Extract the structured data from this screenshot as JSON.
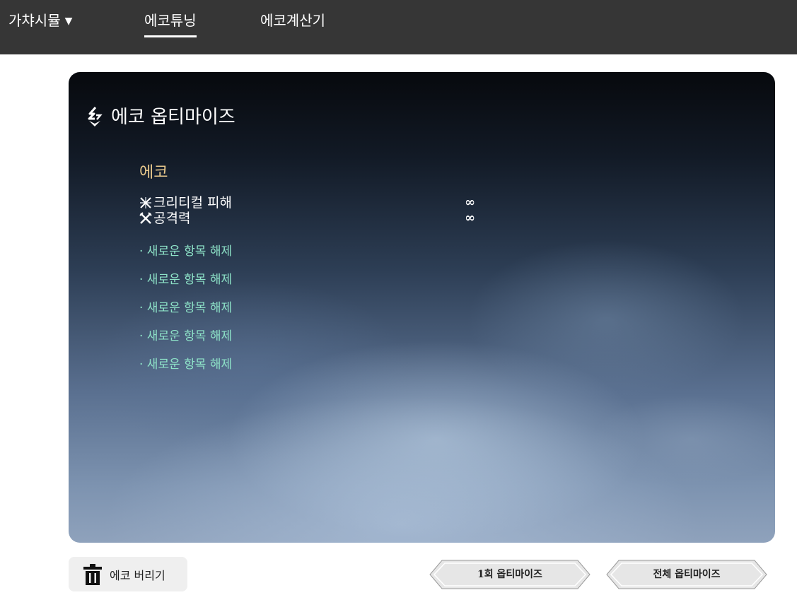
{
  "nav": {
    "gacha_label": "가챠시뮬",
    "gacha_caret": "▼",
    "tuning_label": "에코튜닝",
    "calculator_label": "에코계산기"
  },
  "panel": {
    "title": "에코 옵티마이즈",
    "echo_heading": "에코",
    "stats": [
      {
        "name": "크리티컬 피해",
        "value": "∞",
        "icon": "crit-damage-icon"
      },
      {
        "name": "공격력",
        "value": "∞",
        "icon": "attack-icon"
      }
    ],
    "unlock_slots": [
      "· 새로운 항목 해제",
      "· 새로운 항목 해제",
      "· 새로운 항목 해제",
      "· 새로운 항목 해제",
      "· 새로운 항목 해제"
    ]
  },
  "actions": {
    "discard_label": "에코 버리기",
    "optimize_once_label": "1회 옵티마이즈",
    "optimize_all_label": "전체 옵티마이즈"
  },
  "colors": {
    "topbar": "#363636",
    "echo_heading": "#e9c98c",
    "unlock_text": "#8ee3c8"
  }
}
